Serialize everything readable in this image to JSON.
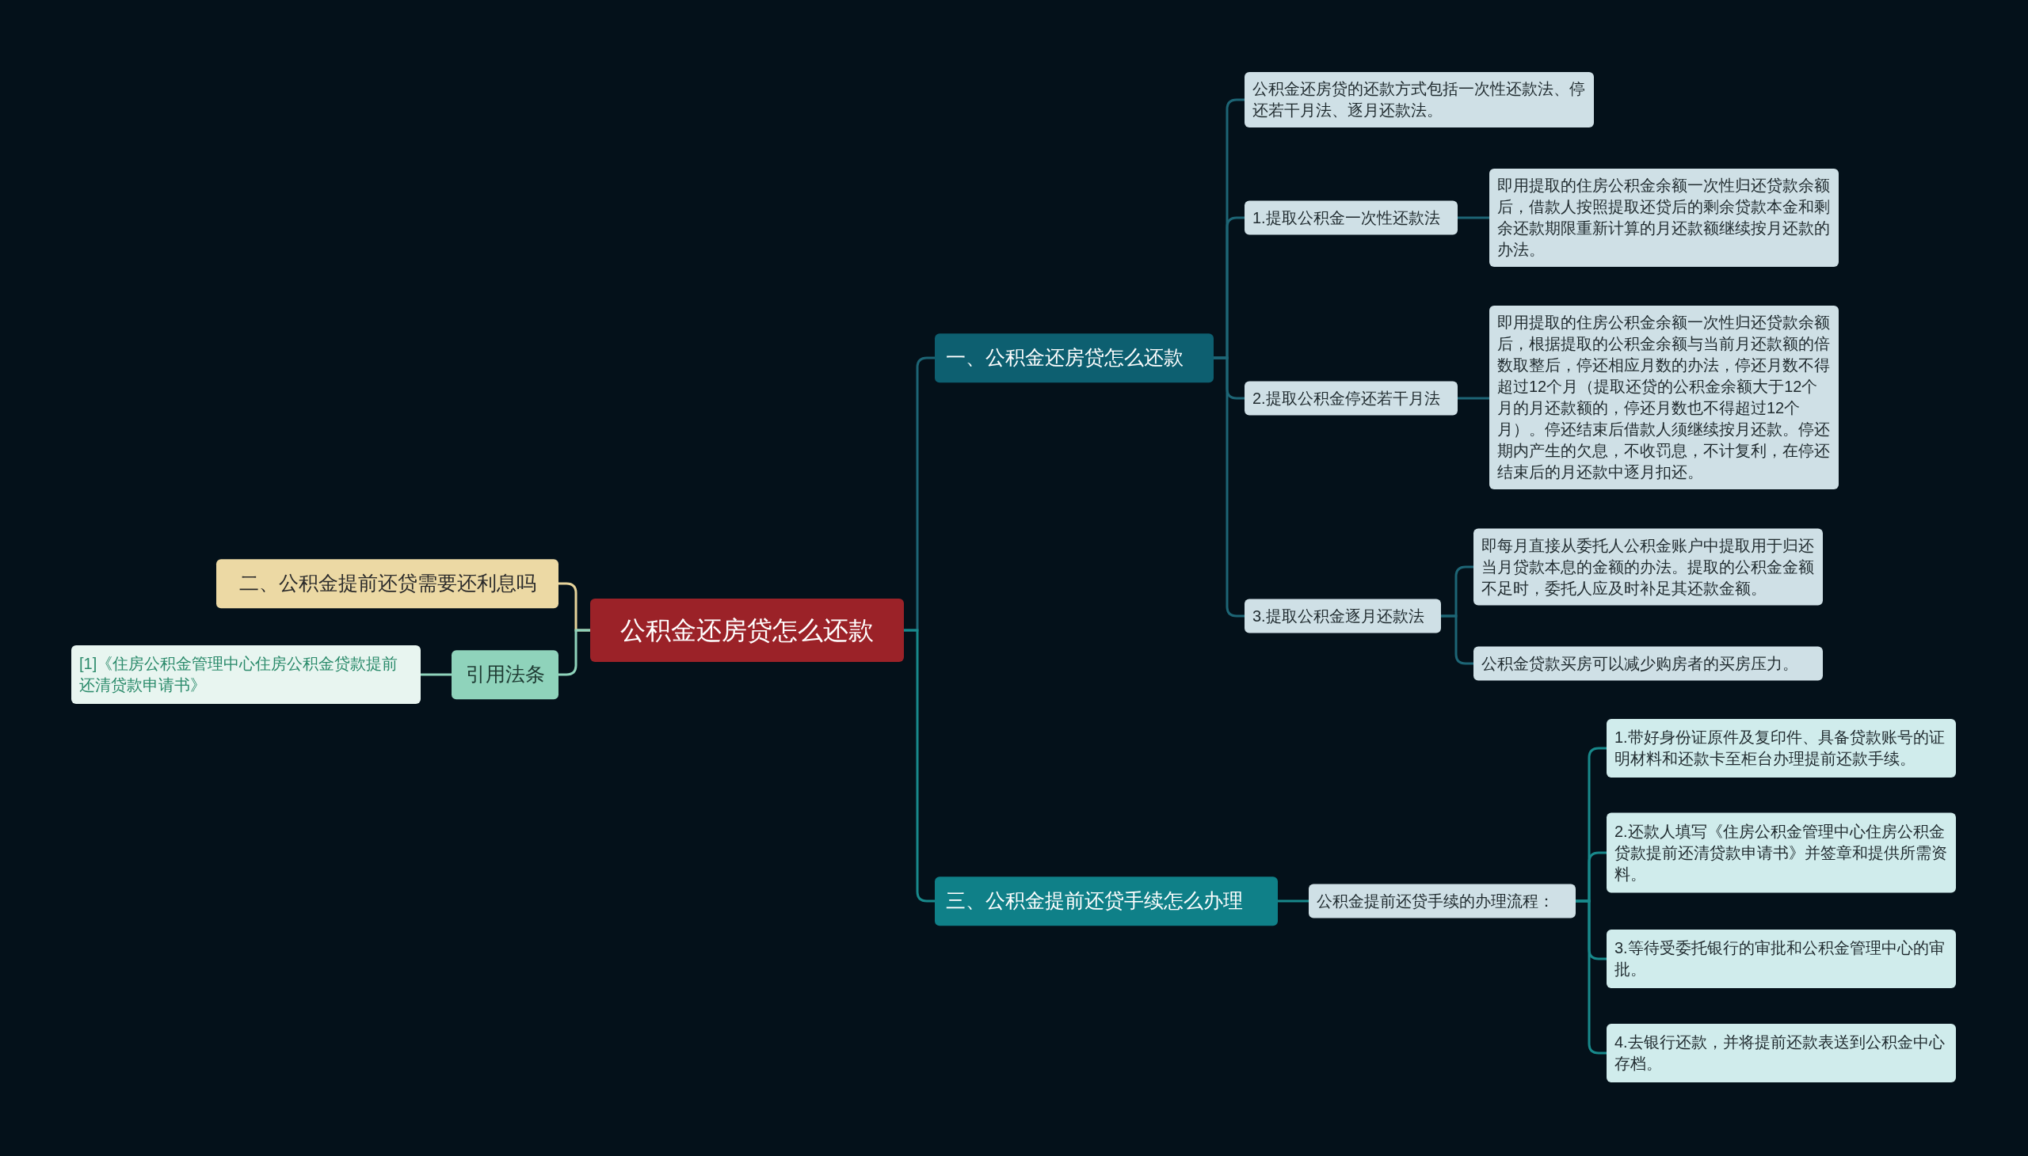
{
  "root": {
    "label": "公积金还房贷怎么还款",
    "kind": "root"
  },
  "left_branches": [
    {
      "label": "二、公积金提前还贷需要还利息吗",
      "kind": "question"
    },
    {
      "label": "引用法条",
      "kind": "reference",
      "children": [
        {
          "label": "[1]《住房公积金管理中心住房公积金贷款提前还清贷款申请书》",
          "kind": "citation"
        }
      ]
    }
  ],
  "right_branches": [
    {
      "label": "一、公积金还房贷怎么还款",
      "kind": "section",
      "children": [
        {
          "label": "公积金还房贷的还款方式包括一次性还款法、停还若干月法、逐月还款法。",
          "kind": "note"
        },
        {
          "label": "1.提取公积金一次性还款法",
          "kind": "note",
          "children": [
            {
              "label": "即用提取的住房公积金余额一次性归还贷款余额后，借款人按照提取还贷后的剩余贷款本金和剩余还款期限重新计算的月还款额继续按月还款的办法。",
              "kind": "note"
            }
          ]
        },
        {
          "label": "2.提取公积金停还若干月法",
          "kind": "note",
          "children": [
            {
              "label": "即用提取的住房公积金余额一次性归还贷款余额后，根据提取的公积金余额与当前月还款额的倍数取整后，停还相应月数的办法，停还月数不得超过12个月（提取还贷的公积金余额大于12个月的月还款额的，停还月数也不得超过12个月）。停还结束后借款人须继续按月还款。停还期内产生的欠息，不收罚息，不计复利，在停还结束后的月还款中逐月扣还。",
              "kind": "note"
            }
          ]
        },
        {
          "label": "3.提取公积金逐月还款法",
          "kind": "note",
          "children": [
            {
              "label": "即每月直接从委托人公积金账户中提取用于归还当月贷款本息的金额的办法。提取的公积金金额不足时，委托人应及时补足其还款金额。",
              "kind": "note"
            },
            {
              "label": "公积金贷款买房可以减少购房者的买房压力。",
              "kind": "note"
            }
          ]
        }
      ]
    },
    {
      "label": "三、公积金提前还贷手续怎么办理",
      "kind": "section_alt",
      "children": [
        {
          "label": "公积金提前还贷手续的办理流程：",
          "kind": "note",
          "children": [
            {
              "label": "1.带好身份证原件及复印件、具备贷款账号的证明材料和还款卡至柜台办理提前还款手续。",
              "kind": "step"
            },
            {
              "label": "2.还款人填写《住房公积金管理中心住房公积金贷款提前还清贷款申请书》并签章和提供所需资料。",
              "kind": "step"
            },
            {
              "label": "3.等待受委托银行的审批和公积金管理中心的审批。",
              "kind": "step"
            },
            {
              "label": "4.去银行还款，并将提前还款表送到公积金中心存档。",
              "kind": "step"
            }
          ]
        }
      ]
    }
  ]
}
